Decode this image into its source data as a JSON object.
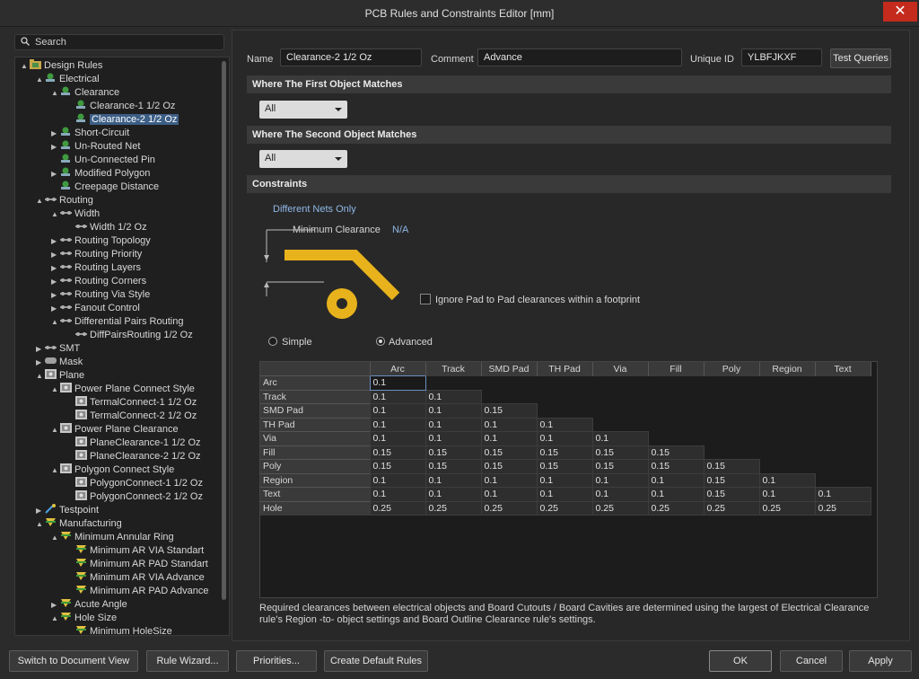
{
  "window": {
    "title": "PCB Rules and Constraints Editor [mm]",
    "close": "✕"
  },
  "search": {
    "placeholder": "Search"
  },
  "tree": [
    {
      "label": "Design Rules",
      "t": "▲",
      "icon": "folder",
      "lvl": 0
    },
    {
      "label": "Electrical",
      "t": "▲",
      "icon": "rule",
      "lvl": 1
    },
    {
      "label": "Clearance",
      "t": "▲",
      "icon": "rule",
      "lvl": 2
    },
    {
      "label": "Clearance-1 1/2 Oz",
      "t": "",
      "icon": "rule",
      "lvl": 3
    },
    {
      "label": "Clearance-2 1/2 Oz",
      "t": "",
      "icon": "rule",
      "lvl": 3,
      "selected": true
    },
    {
      "label": "Short-Circuit",
      "t": "▶",
      "icon": "rule",
      "lvl": 2
    },
    {
      "label": "Un-Routed Net",
      "t": "▶",
      "icon": "rule",
      "lvl": 2
    },
    {
      "label": "Un-Connected Pin",
      "t": "",
      "icon": "rule",
      "lvl": 2
    },
    {
      "label": "Modified Polygon",
      "t": "▶",
      "icon": "rule",
      "lvl": 2
    },
    {
      "label": "Creepage Distance",
      "t": "",
      "icon": "rule",
      "lvl": 2
    },
    {
      "label": "Routing",
      "t": "▲",
      "icon": "route",
      "lvl": 1
    },
    {
      "label": "Width",
      "t": "▲",
      "icon": "route",
      "lvl": 2
    },
    {
      "label": "Width 1/2 Oz",
      "t": "",
      "icon": "route",
      "lvl": 3
    },
    {
      "label": "Routing Topology",
      "t": "▶",
      "icon": "route",
      "lvl": 2
    },
    {
      "label": "Routing Priority",
      "t": "▶",
      "icon": "route",
      "lvl": 2
    },
    {
      "label": "Routing Layers",
      "t": "▶",
      "icon": "route",
      "lvl": 2
    },
    {
      "label": "Routing Corners",
      "t": "▶",
      "icon": "route",
      "lvl": 2
    },
    {
      "label": "Routing Via Style",
      "t": "▶",
      "icon": "route",
      "lvl": 2
    },
    {
      "label": "Fanout Control",
      "t": "▶",
      "icon": "route",
      "lvl": 2
    },
    {
      "label": "Differential Pairs Routing",
      "t": "▲",
      "icon": "route",
      "lvl": 2
    },
    {
      "label": "DiffPairsRouting 1/2 Oz",
      "t": "",
      "icon": "route",
      "lvl": 3
    },
    {
      "label": "SMT",
      "t": "▶",
      "icon": "route",
      "lvl": 1
    },
    {
      "label": "Mask",
      "t": "▶",
      "icon": "mask",
      "lvl": 1
    },
    {
      "label": "Plane",
      "t": "▲",
      "icon": "plane",
      "lvl": 1
    },
    {
      "label": "Power Plane Connect Style",
      "t": "▲",
      "icon": "plane",
      "lvl": 2
    },
    {
      "label": "TermalConnect-1 1/2 Oz",
      "t": "",
      "icon": "plane",
      "lvl": 3
    },
    {
      "label": "TermalConnect-2 1/2 Oz",
      "t": "",
      "icon": "plane",
      "lvl": 3
    },
    {
      "label": "Power Plane Clearance",
      "t": "▲",
      "icon": "plane",
      "lvl": 2
    },
    {
      "label": "PlaneClearance-1 1/2 Oz",
      "t": "",
      "icon": "plane",
      "lvl": 3
    },
    {
      "label": "PlaneClearance-2 1/2 Oz",
      "t": "",
      "icon": "plane",
      "lvl": 3
    },
    {
      "label": "Polygon Connect Style",
      "t": "▲",
      "icon": "plane",
      "lvl": 2
    },
    {
      "label": "PolygonConnect-1 1/2 Oz",
      "t": "",
      "icon": "plane",
      "lvl": 3
    },
    {
      "label": "PolygonConnect-2 1/2 Oz",
      "t": "",
      "icon": "plane",
      "lvl": 3
    },
    {
      "label": "Testpoint",
      "t": "▶",
      "icon": "test",
      "lvl": 1
    },
    {
      "label": "Manufacturing",
      "t": "▲",
      "icon": "mfg",
      "lvl": 1
    },
    {
      "label": "Minimum Annular Ring",
      "t": "▲",
      "icon": "mfg",
      "lvl": 2
    },
    {
      "label": "Minimum AR VIA Standart",
      "t": "",
      "icon": "mfg",
      "lvl": 3
    },
    {
      "label": "Minimum AR PAD Standart",
      "t": "",
      "icon": "mfg",
      "lvl": 3
    },
    {
      "label": "Minimum AR VIA Advance",
      "t": "",
      "icon": "mfg",
      "lvl": 3
    },
    {
      "label": "Minimum AR PAD Advance",
      "t": "",
      "icon": "mfg",
      "lvl": 3
    },
    {
      "label": "Acute Angle",
      "t": "▶",
      "icon": "mfg",
      "lvl": 2
    },
    {
      "label": "Hole Size",
      "t": "▲",
      "icon": "mfg",
      "lvl": 2
    },
    {
      "label": "Minimum HoleSize",
      "t": "",
      "icon": "mfg",
      "lvl": 3
    }
  ],
  "header": {
    "name_label": "Name",
    "name_value": "Clearance-2 1/2 Oz",
    "comment_label": "Comment",
    "comment_value": "Advance",
    "uid_label": "Unique ID",
    "uid_value": "YLBFJKXF",
    "test_queries": "Test Queries"
  },
  "first": {
    "title": "Where The First Object Matches",
    "value": "All"
  },
  "second": {
    "title": "Where The Second Object Matches",
    "value": "All"
  },
  "constraints": {
    "title": "Constraints",
    "diff_nets": "Different Nets Only",
    "min_clear": "Minimum Clearance",
    "na": "N/A",
    "ignore_pad": "Ignore Pad to Pad clearances within a footprint",
    "simple": "Simple",
    "advanced": "Advanced",
    "mode": "advanced"
  },
  "grid": {
    "columns": [
      "Arc",
      "Track",
      "SMD Pad",
      "TH Pad",
      "Via",
      "Fill",
      "Poly",
      "Region",
      "Text"
    ],
    "rows": [
      {
        "name": "Arc",
        "values": [
          "0.1"
        ]
      },
      {
        "name": "Track",
        "values": [
          "0.1",
          "0.1"
        ]
      },
      {
        "name": "SMD Pad",
        "values": [
          "0.1",
          "0.1",
          "0.15"
        ]
      },
      {
        "name": "TH Pad",
        "values": [
          "0.1",
          "0.1",
          "0.1",
          "0.1"
        ]
      },
      {
        "name": "Via",
        "values": [
          "0.1",
          "0.1",
          "0.1",
          "0.1",
          "0.1"
        ]
      },
      {
        "name": "Fill",
        "values": [
          "0.15",
          "0.15",
          "0.15",
          "0.15",
          "0.15",
          "0.15"
        ]
      },
      {
        "name": "Poly",
        "values": [
          "0.15",
          "0.15",
          "0.15",
          "0.15",
          "0.15",
          "0.15",
          "0.15"
        ]
      },
      {
        "name": "Region",
        "values": [
          "0.1",
          "0.1",
          "0.1",
          "0.1",
          "0.1",
          "0.1",
          "0.15",
          "0.1"
        ]
      },
      {
        "name": "Text",
        "values": [
          "0.1",
          "0.1",
          "0.1",
          "0.1",
          "0.1",
          "0.1",
          "0.15",
          "0.1",
          "0.1"
        ]
      },
      {
        "name": "Hole",
        "values": [
          "0.25",
          "0.25",
          "0.25",
          "0.25",
          "0.25",
          "0.25",
          "0.25",
          "0.25",
          "0.25"
        ]
      }
    ]
  },
  "note": "Required clearances between electrical objects and Board Cutouts / Board Cavities are determined using the largest of Electrical Clearance rule's Region -to- object settings and Board Outline Clearance rule's settings.",
  "footer": {
    "doc_view": "Switch to Document View",
    "wizard": "Rule Wizard...",
    "priorities": "Priorities...",
    "defaults": "Create Default Rules",
    "ok": "OK",
    "cancel": "Cancel",
    "apply": "Apply"
  },
  "colors": {
    "accent": "#e8b21c",
    "selected": "#3d5f86",
    "link": "#8fb8e8"
  }
}
